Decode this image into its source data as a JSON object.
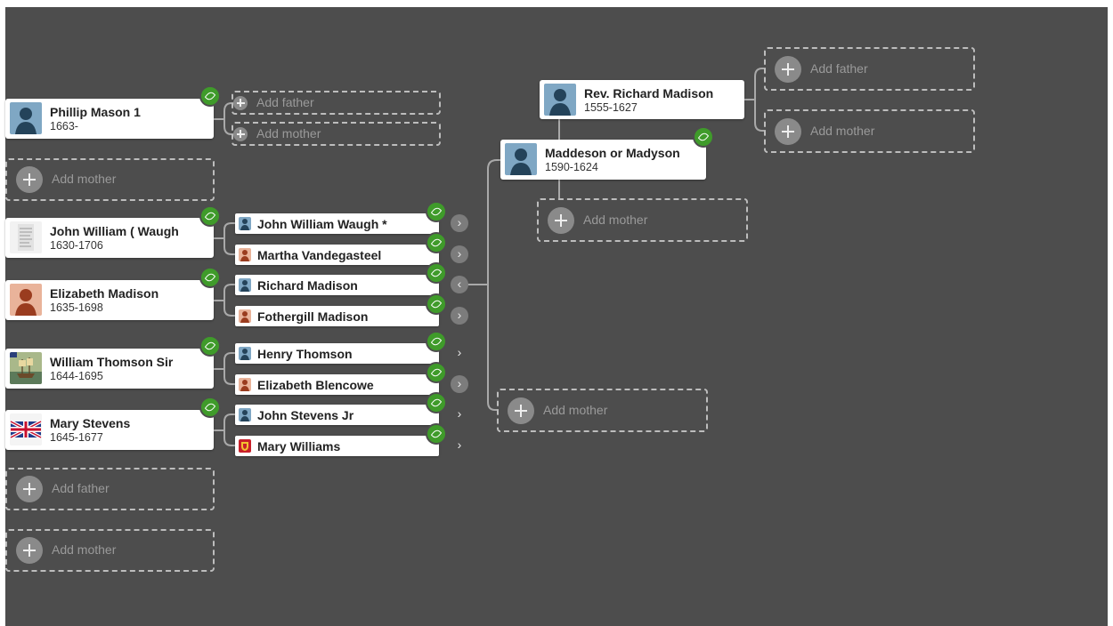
{
  "tree": {
    "root": [
      {
        "name": "Phillip Mason 1",
        "dates": "1663-",
        "avatar": "male-silhouette-icon"
      },
      {
        "name": "John William ( Waugh",
        "dates": "1630-1706",
        "avatar": "document-thumbnail-icon"
      },
      {
        "name": "Elizabeth Madison",
        "dates": "1635-1698",
        "avatar": "female-silhouette-icon"
      },
      {
        "name": "William Thomson Sir",
        "dates": "1644-1695",
        "avatar": "ship-painting-icon"
      },
      {
        "name": "Mary Stevens",
        "dates": "1645-1677",
        "avatar": "union-jack-flag-icon"
      }
    ],
    "parents": [
      {
        "name": "John William Waugh *",
        "avatar": "male-silhouette-icon"
      },
      {
        "name": "Martha Vandegasteel",
        "avatar": "female-silhouette-icon"
      },
      {
        "name": "Richard Madison",
        "avatar": "male-silhouette-icon"
      },
      {
        "name": "Fothergill Madison",
        "avatar": "female-silhouette-icon"
      },
      {
        "name": "Henry Thomson",
        "avatar": "male-silhouette-icon"
      },
      {
        "name": "Elizabeth Blencowe",
        "avatar": "female-silhouette-icon"
      },
      {
        "name": "John Stevens Jr",
        "avatar": "male-silhouette-icon"
      },
      {
        "name": "Mary Williams",
        "avatar": "coat-of-arms-icon"
      }
    ],
    "grand": [
      {
        "name": "Maddeson or Madyson",
        "dates": "1590-1624",
        "avatar": "male-silhouette-icon"
      },
      {
        "name": "Rev. Richard Madison",
        "dates": "1555-1627",
        "avatar": "male-silhouette-icon"
      }
    ],
    "add_father": "Add father",
    "add_mother": "Add mother"
  },
  "colors": {
    "canvas": "#4d4d4d",
    "hint": "#3f9b2a",
    "male_avatar": "#7fa7c4",
    "female_avatar": "#d98a6d"
  }
}
